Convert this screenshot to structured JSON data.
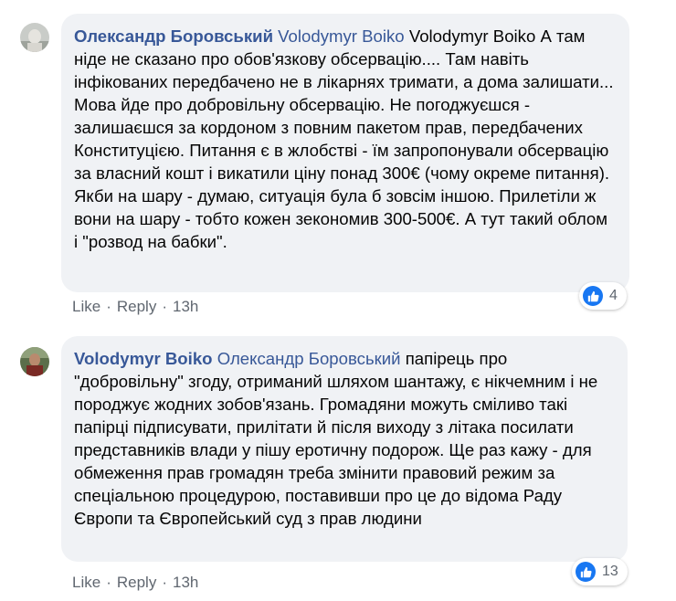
{
  "comments": [
    {
      "author": "Олександр Боровський",
      "mention": "Volodymyr Boiko",
      "text": " Volodymyr Boiko А там ніде не сказано про обов'язкову обсервацію.... Там навіть інфікованих передбачено не в лікарнях тримати, а дома залишати... Мова йде про добровільну обсервацію. Не погоджуєшся - залишаєшся за кордоном з повним пакетом прав, передбачених Конституцією. Питання є в жлобстві - їм запропонували обсервацію за власний кошт і викатили ціну понад 300€ (чому окреме питання). Якби на шару - думаю, ситуація була б зовсім іншою. Прилетіли ж вони на шару - тобто кожен зекономив 300-500€. А тут такий облом і \"розвод на бабки\".",
      "like_label": "Like",
      "reply_label": "Reply",
      "time": "13h",
      "reaction_count": "4",
      "reaction_icon": "thumbs-up-icon"
    },
    {
      "author": "Volodymyr Boiko",
      "mention": "Олександр Боровський",
      "text": " папірець про \"добровільну\" згоду, отриманий шляхом шантажу, є нікчемним і не породжує жодних зобов'язань. Громадяни можуть сміливо такі папірці підписувати, прилітати й після виходу з літака посилати представників влади у пішу еротичну подорож. Ще раз кажу - для обмеження прав громадян треба змінити правовий режим за спеціальною процедурою, поставивши про це до відома Раду Європи та Європейський суд з прав людини",
      "like_label": "Like",
      "reply_label": "Reply",
      "time": "13h",
      "reaction_count": "13",
      "reaction_icon": "thumbs-up-icon"
    }
  ],
  "separator": "·",
  "colors": {
    "author": "#385898",
    "bubble_bg": "#f0f2f5",
    "meta": "#606770",
    "like_blue": "#1877f2"
  }
}
